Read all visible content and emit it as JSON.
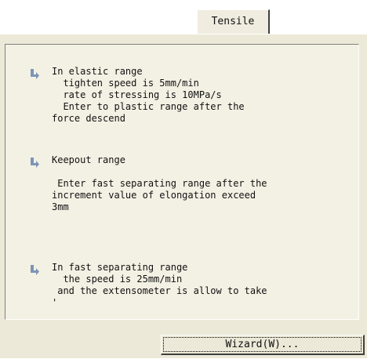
{
  "tab": {
    "label": "Tensile"
  },
  "sections": [
    {
      "icon": "step-arrow-icon",
      "lines": [
        "In elastic range",
        "  tighten speed is 5mm/min",
        "  rate of stressing is 10MPa/s",
        "  Enter to plastic range after the",
        "force descend"
      ]
    },
    {
      "icon": "step-arrow-icon",
      "lines": [
        "Keepout range",
        "",
        " Enter fast separating range after the",
        "increment value of elongation exceed",
        "3mm"
      ]
    },
    {
      "icon": "step-arrow-icon",
      "lines": [
        "In fast separating range",
        "  the speed is 25mm/min",
        " and the extensometer is allow to take",
        "'"
      ]
    }
  ],
  "footer": {
    "wizard_button_label": "Wizard(W)..."
  },
  "colors": {
    "panel_bg": "#ece9d8",
    "content_bg": "#f3f1e4",
    "arrow": "#7c95b6"
  }
}
